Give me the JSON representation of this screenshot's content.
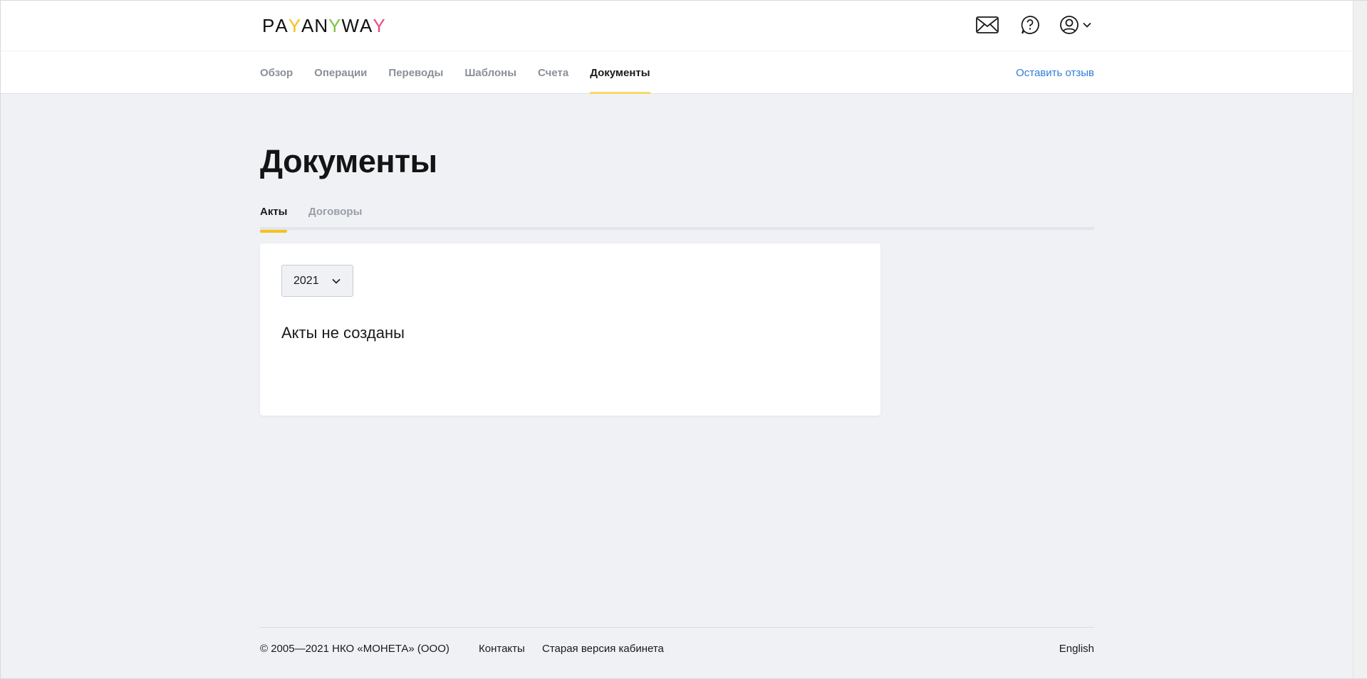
{
  "header": {
    "logo_letters": [
      "P",
      "A",
      "Y",
      "A",
      "N",
      "Y",
      "W",
      "A",
      "Y"
    ],
    "icons": [
      "mail-icon",
      "help-icon",
      "user-icon",
      "chevron-down-icon"
    ]
  },
  "nav": {
    "items": [
      {
        "label": "Обзор"
      },
      {
        "label": "Операции"
      },
      {
        "label": "Переводы"
      },
      {
        "label": "Шаблоны"
      },
      {
        "label": "Счета"
      },
      {
        "label": "Документы",
        "active": true
      }
    ],
    "feedback": "Оставить отзыв"
  },
  "main": {
    "title": "Документы",
    "tabs": [
      {
        "label": "Акты",
        "active": true
      },
      {
        "label": "Договоры"
      }
    ],
    "year_select": {
      "value": "2021"
    },
    "empty_message": "Акты не созданы"
  },
  "footer": {
    "copyright": "© 2005—2021 НКО «МОНЕТА» (ООО)",
    "contacts": "Контакты",
    "old_version": "Старая версия кабинета",
    "language": "English"
  },
  "colors": {
    "accent_yellow": "#f5c21b",
    "accent_green": "#7fc241",
    "accent_pink": "#e84a7f",
    "link_blue": "#2f7fd6",
    "background": "#eff1f5"
  }
}
